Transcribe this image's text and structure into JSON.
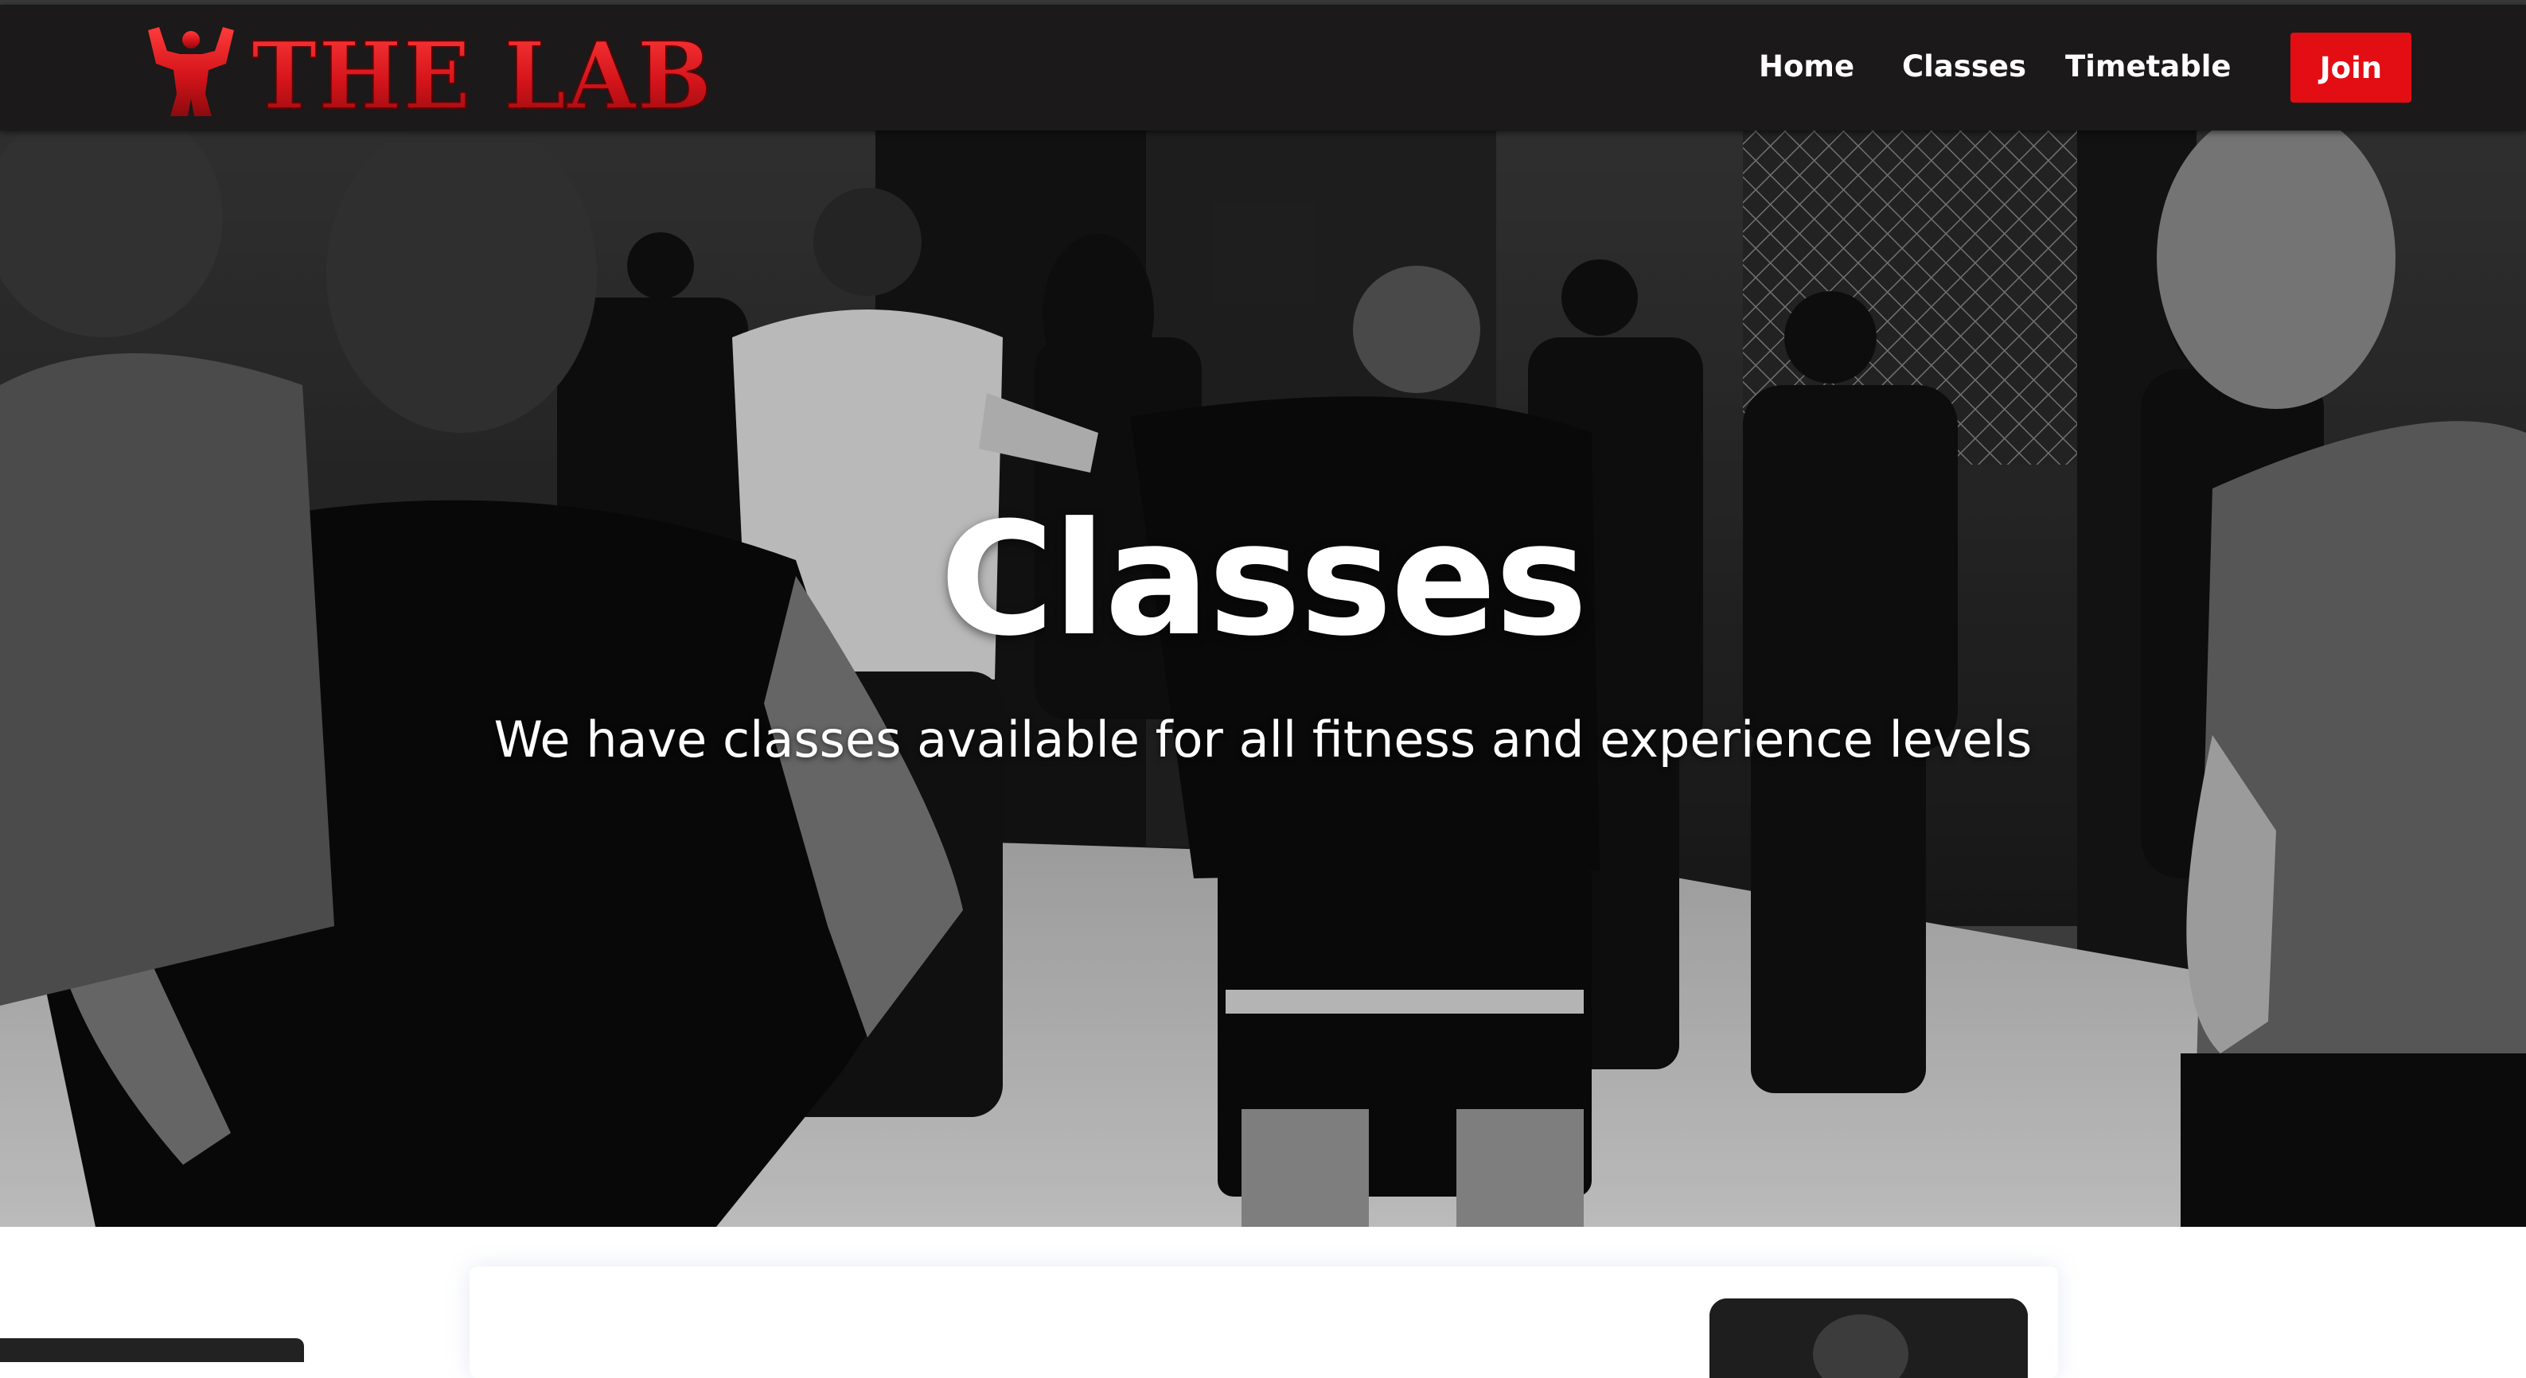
{
  "brand": {
    "name": "THE LAB",
    "accent": "#e30d14",
    "nav_bg": "#1b1919"
  },
  "nav": {
    "home": "Home",
    "classes": "Classes",
    "timetable": "Timetable",
    "join": "Join"
  },
  "hero": {
    "title": "Classes",
    "subtitle": "We have classes available for all fitness and experience levels",
    "image": "black-and-white photo of a martial arts class gathered on mats around a coach and pad holder"
  },
  "icons": {
    "logo_figure": "flexing-figure-icon"
  }
}
